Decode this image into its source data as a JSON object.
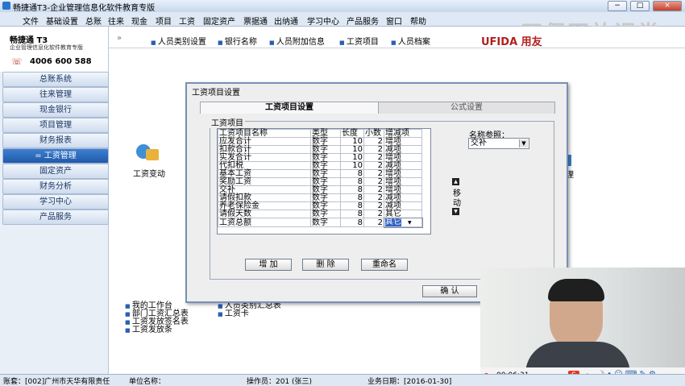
{
  "app": {
    "title": "畅捷通T3-企业管理信息化软件教育专版"
  },
  "menu": [
    "文件",
    "基础设置",
    "总账",
    "往来",
    "现金",
    "项目",
    "工资",
    "固定资产",
    "票据通",
    "出纳通",
    "学习中心",
    "产品服务",
    "窗口",
    "帮助"
  ],
  "window_buttons": [
    "−",
    "□",
    "×"
  ],
  "watermark": "正保开放课堂",
  "brand": {
    "logo_text": "UFIDA 用友"
  },
  "logo": {
    "name": "畅捷通 T3",
    "subtitle": "企业管理信息化软件教育专版",
    "phone": "4006 600 588"
  },
  "nav": [
    {
      "label": "总账系统"
    },
    {
      "label": "往来管理"
    },
    {
      "label": "现金银行"
    },
    {
      "label": "项目管理"
    },
    {
      "label": "财务报表"
    },
    {
      "label": "工资管理",
      "active": true
    },
    {
      "label": "固定资产"
    },
    {
      "label": "财务分析"
    },
    {
      "label": "学习中心"
    },
    {
      "label": "产品服务"
    }
  ],
  "top_tabs": {
    "arrows": "»",
    "items": [
      "人员类别设置",
      "银行名称",
      "人员附加信息",
      "工资项目",
      "人员档案"
    ]
  },
  "content": {
    "icon_label": "工资变动",
    "right_label": "理",
    "links_left": [
      "我的工作台",
      "部门工资汇总表",
      "工资发放签名表",
      "工资发放条"
    ],
    "links_right": [
      "人员类别汇总表",
      "工资卡"
    ]
  },
  "dialog": {
    "title": "工资项目设置",
    "tabs": [
      "工资项目设置",
      "公式设置"
    ],
    "group_label": "工资项目",
    "columns": [
      "工资项目名称",
      "类型",
      "长度",
      "小数",
      "增减项"
    ],
    "rows": [
      [
        "应发合计",
        "数字",
        "10",
        "2",
        "增项"
      ],
      [
        "扣款合计",
        "数字",
        "10",
        "2",
        "减项"
      ],
      [
        "实发合计",
        "数字",
        "10",
        "2",
        "增项"
      ],
      [
        "代扣税",
        "数字",
        "10",
        "2",
        "减项"
      ],
      [
        "基本工资",
        "数字",
        "8",
        "2",
        "增项"
      ],
      [
        "奖励工资",
        "数字",
        "8",
        "2",
        "增项"
      ],
      [
        "交补",
        "数字",
        "8",
        "2",
        "增项"
      ],
      [
        "请假扣款",
        "数字",
        "8",
        "2",
        "减项"
      ],
      [
        "养老保险金",
        "数字",
        "8",
        "2",
        "减项"
      ],
      [
        "请假天数",
        "数字",
        "8",
        "2",
        "其它"
      ],
      [
        "工资总额",
        "数字",
        "8",
        "2",
        "其它"
      ]
    ],
    "name_ref_label": "名称参照：",
    "name_ref_value": "交补",
    "move_label": "移动",
    "buttons": {
      "add": "增 加",
      "delete": "删 除",
      "rename": "重命名",
      "ok": "确 认"
    }
  },
  "status": {
    "account": "账套：[002]广州市天华有限责任",
    "unit": "单位名称：",
    "operator": "操作员：201 (张三)",
    "date": "业务日期：[2016-01-30]"
  },
  "recorder": {
    "time": "00:06:31",
    "ime": "中"
  },
  "colors": {
    "accent": "#1f5aa9",
    "dialog_border": "#7791b6"
  }
}
